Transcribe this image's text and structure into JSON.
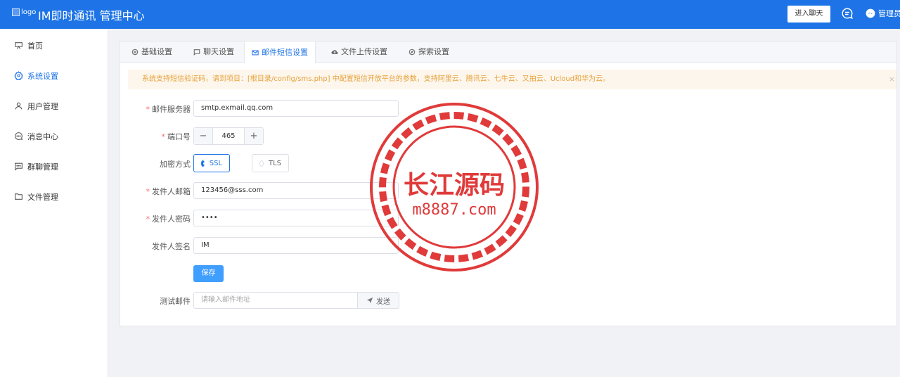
{
  "header": {
    "logo_alt": "logo",
    "title": "IM即时通讯 管理中心",
    "enter_chat": "进入聊天",
    "admin": "管理员"
  },
  "sidebar": {
    "items": [
      {
        "label": "首页",
        "icon": "home-icon"
      },
      {
        "label": "系统设置",
        "icon": "gear-icon"
      },
      {
        "label": "用户管理",
        "icon": "user-icon"
      },
      {
        "label": "消息中心",
        "icon": "message-icon"
      },
      {
        "label": "群聊管理",
        "icon": "group-chat-icon"
      },
      {
        "label": "文件管理",
        "icon": "folder-icon"
      }
    ],
    "active_index": 1
  },
  "tabs": [
    {
      "label": "基础设置",
      "icon": "gear-icon"
    },
    {
      "label": "聊天设置",
      "icon": "chat-icon"
    },
    {
      "label": "邮件短信设置",
      "icon": "mail-icon"
    },
    {
      "label": "文件上传设置",
      "icon": "cloud-upload-icon"
    },
    {
      "label": "探索设置",
      "icon": "compass-icon"
    }
  ],
  "active_tab": 2,
  "alert": {
    "text": "系统支持短信验证码，请到项目：[根目录/config/sms.php] 中配置短信开放平台的参数，支持阿里云、腾讯云、七牛云、又拍云、Ucloud和华为云。",
    "close": "×"
  },
  "form": {
    "mail_server": {
      "label": "邮件服务器",
      "value": "smtp.exmail.qq.com"
    },
    "port": {
      "label": "端口号",
      "value": "465",
      "minus": "−",
      "plus": "+"
    },
    "encryption": {
      "label": "加密方式",
      "options": [
        "SSL",
        "TLS"
      ],
      "selected": "SSL"
    },
    "sender_email": {
      "label": "发件人邮箱",
      "value": "123456@sss.com"
    },
    "sender_password": {
      "label": "发件人密码",
      "value": "••••"
    },
    "sender_signature": {
      "label": "发件人签名",
      "value": "IM"
    },
    "save": "保存",
    "test_mail": {
      "label": "测试邮件",
      "placeholder": "请输入邮件地址",
      "send": "发送"
    }
  },
  "watermark": {
    "title": "长江源码",
    "site": "m8887.com",
    "color": "#e03a3a"
  },
  "colors": {
    "primary": "#1e74e6",
    "button": "#409eff",
    "warning_bg": "#fdf6ec",
    "warning_text": "#e6a23c",
    "required": "#f56c6c"
  }
}
